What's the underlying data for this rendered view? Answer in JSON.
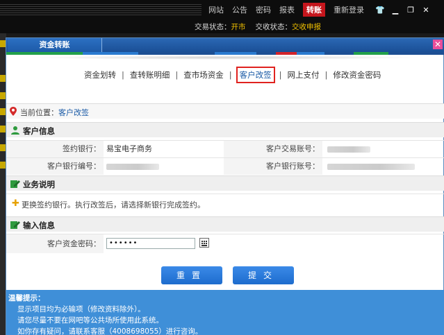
{
  "topbar": {
    "menu": [
      "网站",
      "公告",
      "密码",
      "报表",
      "转账",
      "重新登录"
    ],
    "active_menu": "转账",
    "trade_status_label": "交易状态：",
    "trade_status_value": "开市",
    "settle_status_label": "交收状态：",
    "settle_status_value": "交收申报"
  },
  "dialog": {
    "title": "资金转账",
    "tabs": [
      "资金划转",
      "查转账明细",
      "查市场资金",
      "客户改签",
      "网上支付",
      "修改资金密码"
    ],
    "current_tab": "客户改签",
    "location_label": "当前位置：",
    "location_value": "客户改签",
    "customer_info": {
      "header": "客户信息",
      "sign_bank_label": "签约银行：",
      "sign_bank_value": "易宝电子商务",
      "trade_account_label": "客户交易账号：",
      "bank_id_label": "客户银行编号：",
      "bank_account_label": "客户银行账号："
    },
    "business": {
      "header": "业务说明",
      "text": "更换签约银行。执行改签后，请选择新银行完成签约。"
    },
    "input": {
      "header": "输入信息",
      "password_label": "客户资金密码：",
      "password_value": "••••••"
    },
    "buttons": {
      "reset": "重置",
      "submit": "提交"
    },
    "tips": {
      "title": "温馨提示：",
      "lines": [
        "显示项目均为必输项（修改资料除外）。",
        "请您尽量不要在网吧等公共场所使用此系统。",
        "如你存有疑问，请联系客服（4008698055）进行咨询。"
      ]
    }
  },
  "colors": {
    "accent": "#1a5aa6",
    "highlight": "#e0221f",
    "status": "#f0c000",
    "tips_bg": "#3f8fd8"
  }
}
